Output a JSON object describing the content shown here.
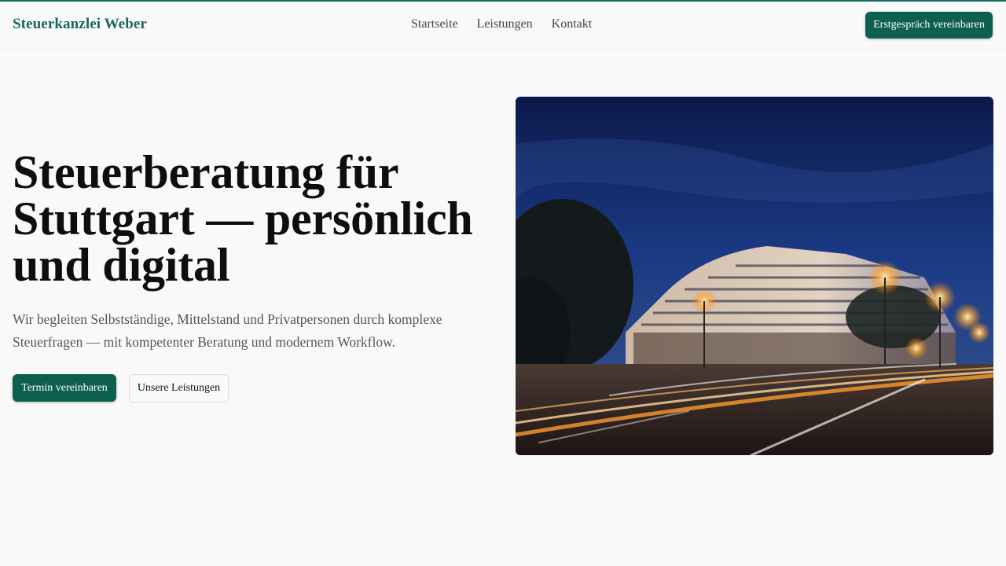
{
  "header": {
    "brand": "Steuerkanzlei Weber",
    "nav": [
      "Startseite",
      "Leistungen",
      "Kontakt"
    ],
    "cta": "Erstgespräch vereinbaren"
  },
  "hero": {
    "title": "Steuerberatung für Stuttgart — persönlich und digital",
    "lede": "Wir begleiten Selbstständige, Mittelstand und Privatpersonen durch komplexe Steuerfragen — mit kompetenter Beratung und modernem Workflow.",
    "primary_button": "Termin vereinbaren",
    "secondary_button": "Unsere Leistungen"
  },
  "colors": {
    "accent": "#0d5f50",
    "brand": "#17695d",
    "background": "#f9f9f9"
  }
}
